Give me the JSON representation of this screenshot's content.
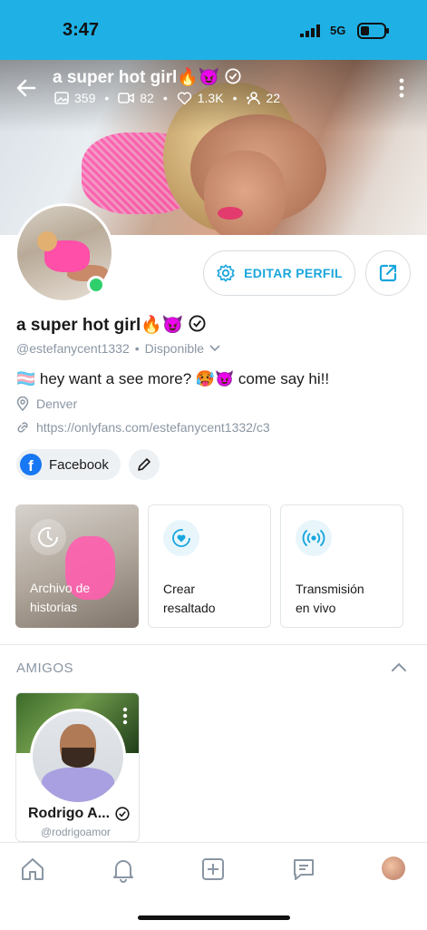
{
  "status_bar": {
    "time": "3:47",
    "network": "5G"
  },
  "cover": {
    "title": "a super hot girl🔥😈",
    "stats": {
      "photos": "359",
      "videos": "82",
      "likes": "1.3K",
      "fans": "22"
    }
  },
  "profile": {
    "edit_button": "EDITAR PERFIL",
    "name": "a super hot girl🔥😈",
    "handle": "@estefanycent1332",
    "separator": "•",
    "availability": "Disponible",
    "bio": "🏳️‍⚧️ hey want a see more? 🥵😈 come say hi!!",
    "location": "Denver",
    "link": "https://onlyfans.com/estefanycent1332/c3",
    "social": "Facebook"
  },
  "highlights": [
    {
      "label": "Archivo de historias"
    },
    {
      "label": "Crear resaltado"
    },
    {
      "label": "Transmisión en vivo"
    }
  ],
  "friends": {
    "heading": "AMIGOS",
    "items": [
      {
        "name": "Rodrigo A...",
        "handle": "@rodrigoamor"
      }
    ]
  },
  "colors": {
    "accent": "#1aa6dd",
    "status_bar": "#1fb1e6",
    "online": "#2fcf6c"
  },
  "icons": [
    "back-arrow-icon",
    "photo-icon",
    "video-icon",
    "heart-icon",
    "fans-icon",
    "kebab-icon",
    "gear-icon",
    "share-icon",
    "verified-icon",
    "chevron-down-icon",
    "location-icon",
    "link-icon",
    "facebook-icon",
    "pencil-icon",
    "history-icon",
    "highlight-heart-icon",
    "live-icon",
    "chevron-up-icon",
    "home-icon",
    "bell-icon",
    "plus-square-icon",
    "message-icon"
  ]
}
